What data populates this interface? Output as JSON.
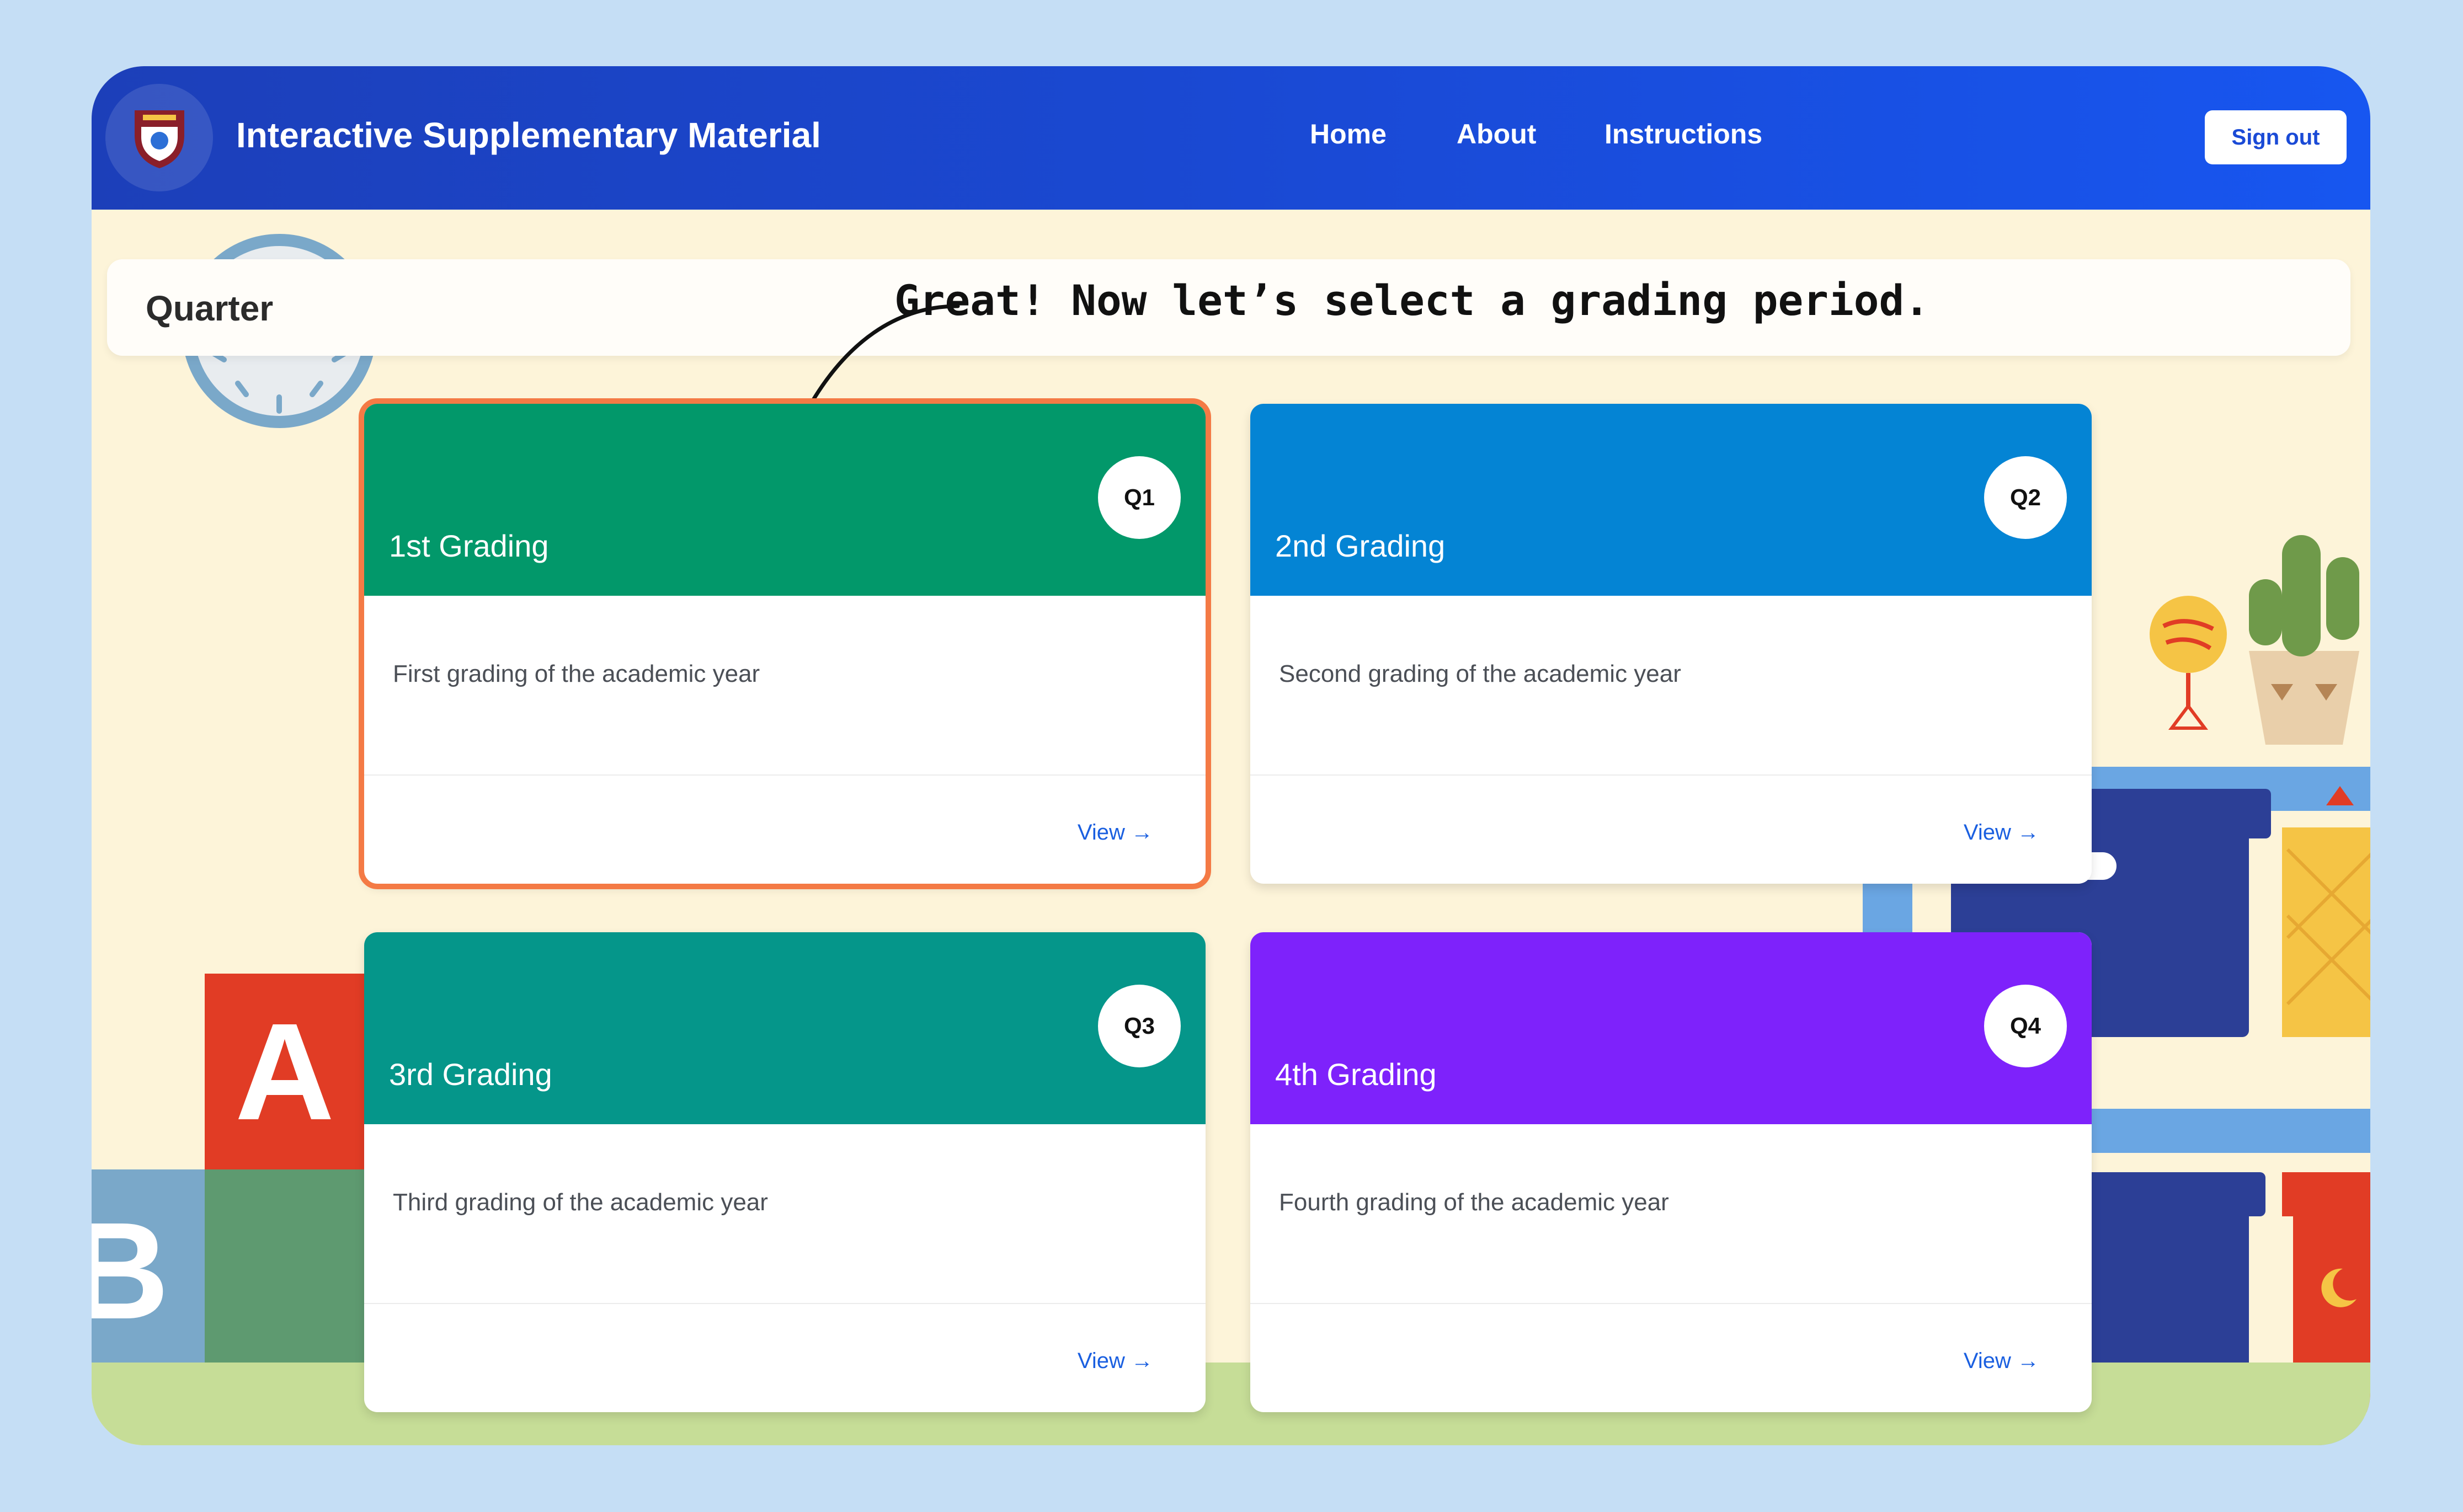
{
  "header": {
    "title": "Interactive Supplementary Material",
    "nav": [
      "Home",
      "About",
      "Instructions"
    ],
    "signout_label": "Sign out"
  },
  "section": {
    "title": "Quarter"
  },
  "annotation": "Great! Now let’s select a grading period.",
  "cards": [
    {
      "title": "1st Grading",
      "badge": "Q1",
      "description": "First grading of the academic year",
      "view_label": "View →",
      "color": "#02986a",
      "selected": true
    },
    {
      "title": "2nd Grading",
      "badge": "Q2",
      "description": "Second grading of the academic year",
      "view_label": "View →",
      "color": "#0484d4",
      "selected": false
    },
    {
      "title": "3rd Grading",
      "badge": "Q3",
      "description": "Third grading of the academic year",
      "view_label": "View →",
      "color": "#05968a",
      "selected": false
    },
    {
      "title": "4th Grading",
      "badge": "Q4",
      "description": "Fourth grading of the academic year",
      "view_label": "View →",
      "color": "#7e22fb",
      "selected": false
    }
  ],
  "decor": {
    "block_a": "A",
    "block_b": "B"
  },
  "colors": {
    "nav_bg": "#1a4ad6",
    "page_bg": "#fdf4d9",
    "outer_bg": "#c5def5",
    "selection": "#f47a45"
  }
}
